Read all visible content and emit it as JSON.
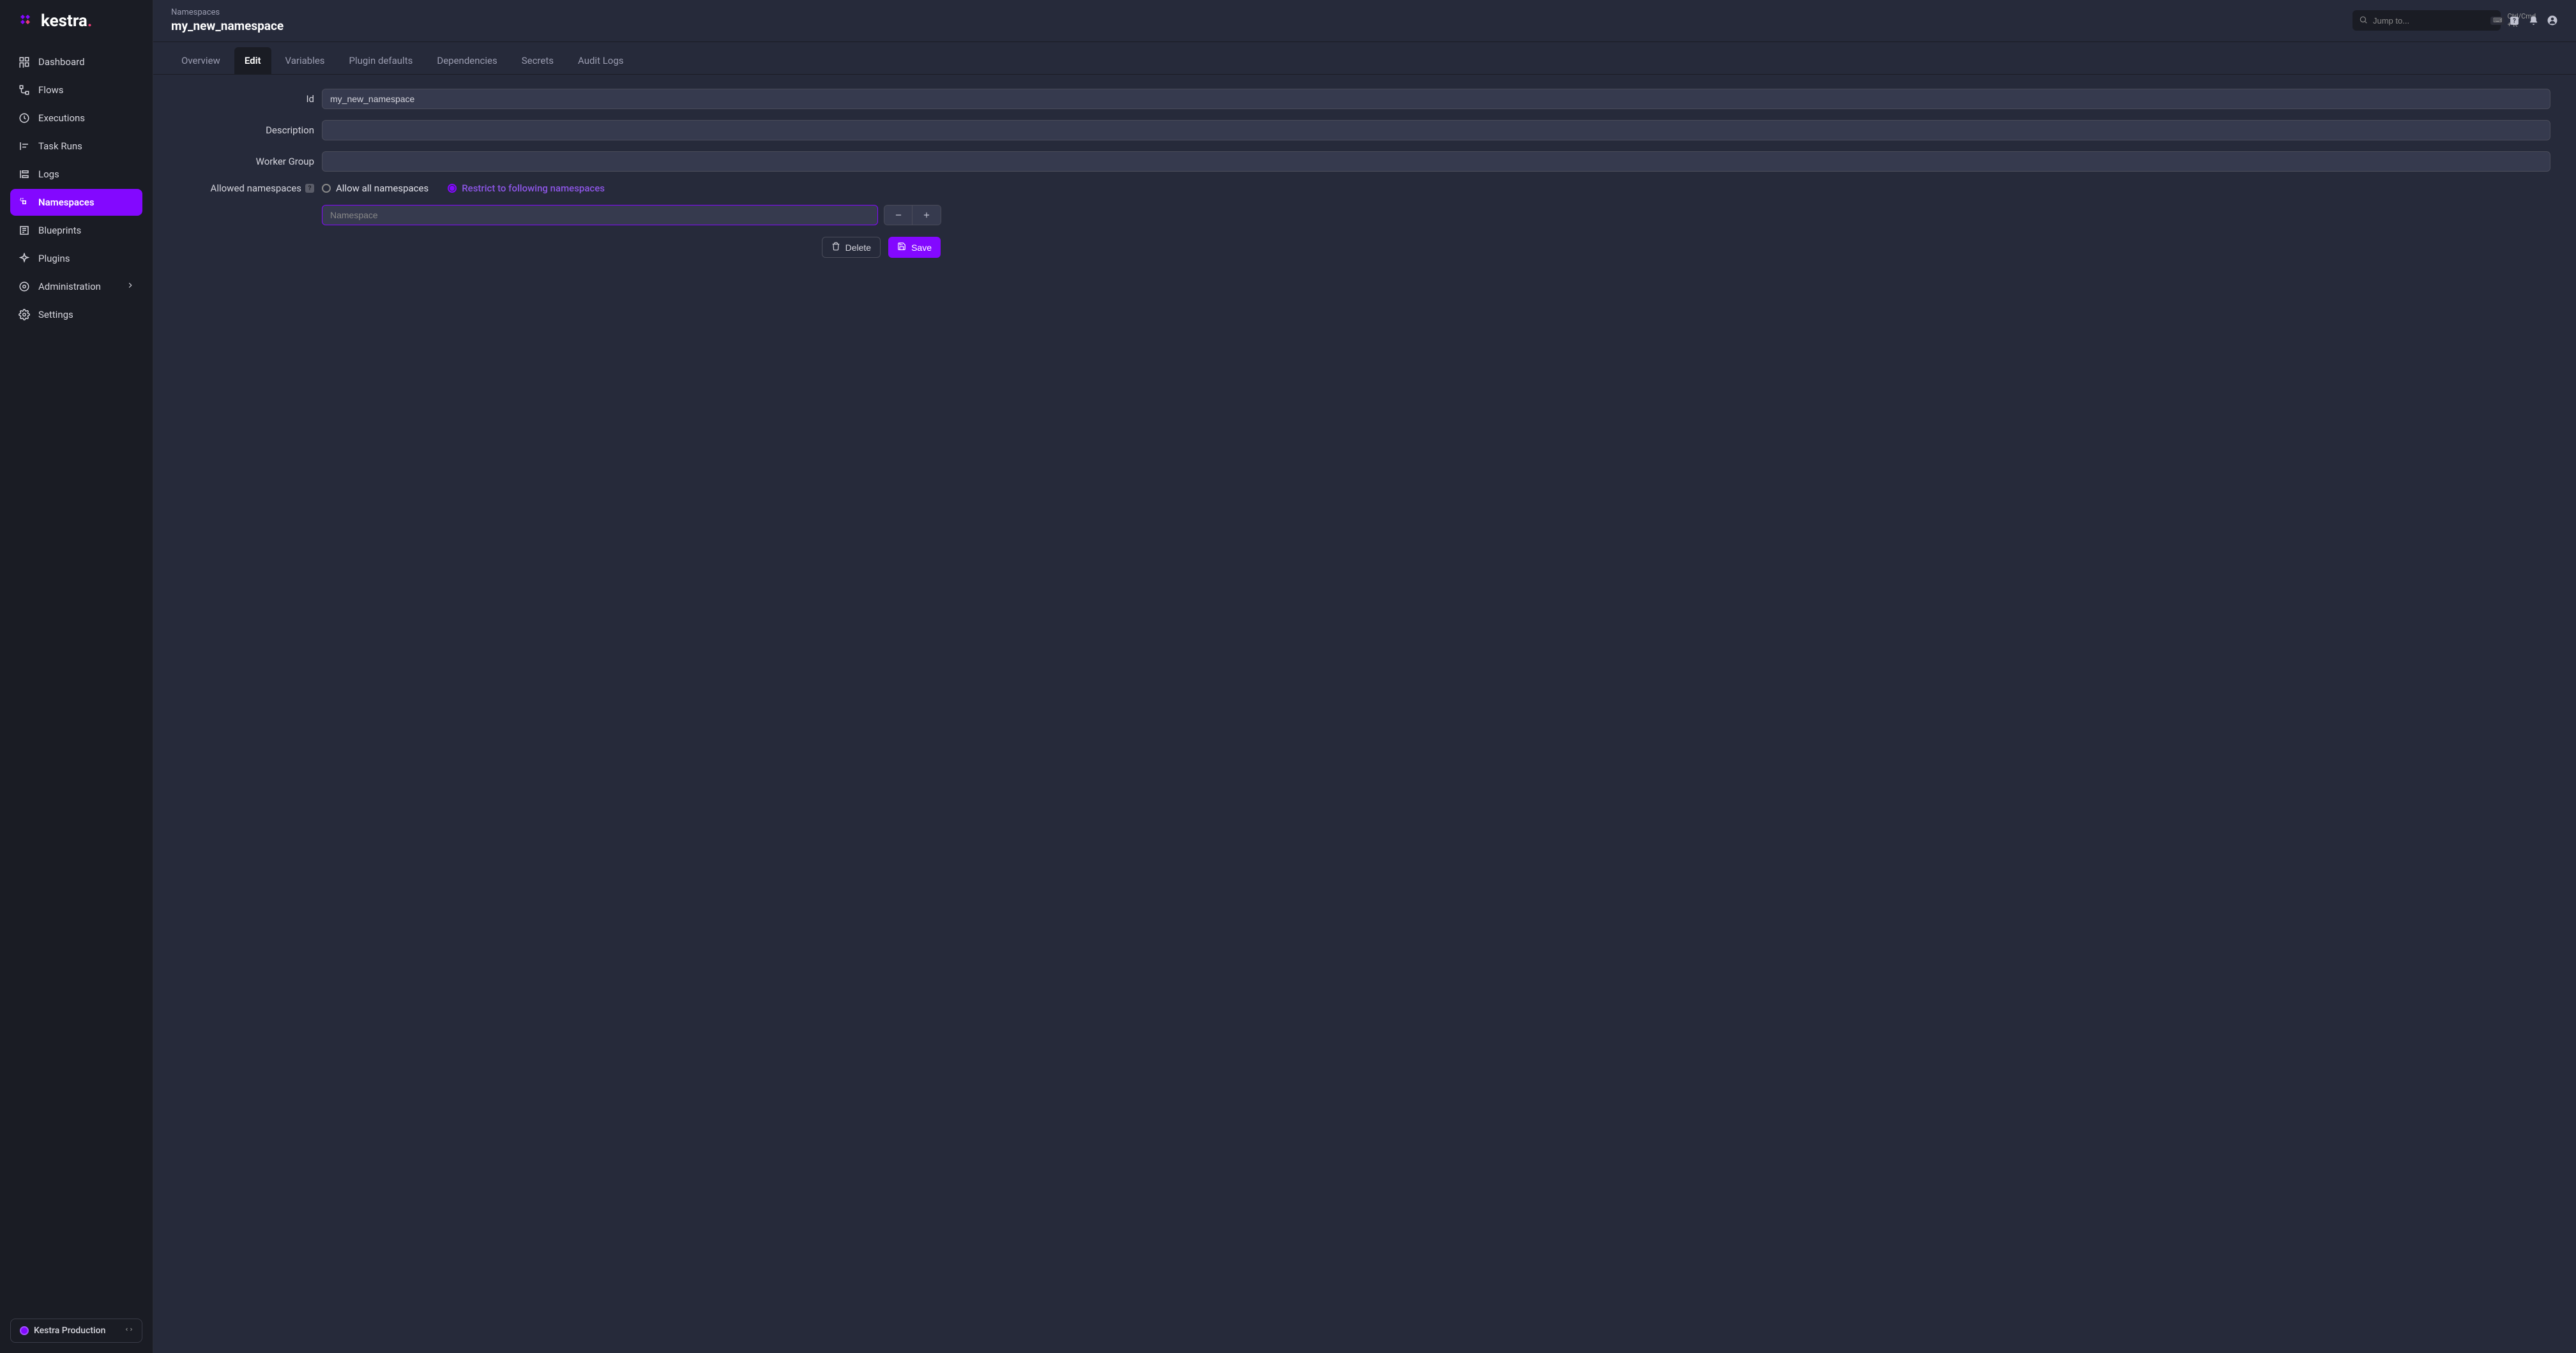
{
  "brand": {
    "name": "kestra"
  },
  "sidebar": {
    "items": [
      {
        "label": "Dashboard"
      },
      {
        "label": "Flows"
      },
      {
        "label": "Executions"
      },
      {
        "label": "Task Runs"
      },
      {
        "label": "Logs"
      },
      {
        "label": "Namespaces"
      },
      {
        "label": "Blueprints"
      },
      {
        "label": "Plugins"
      },
      {
        "label": "Administration"
      },
      {
        "label": "Settings"
      }
    ],
    "instance": "Kestra Production"
  },
  "header": {
    "breadcrumb": "Namespaces",
    "title": "my_new_namespace",
    "search_placeholder": "Jump to...",
    "shortcut": "Ctrl/Cmd + K"
  },
  "tabs": [
    {
      "label": "Overview"
    },
    {
      "label": "Edit"
    },
    {
      "label": "Variables"
    },
    {
      "label": "Plugin defaults"
    },
    {
      "label": "Dependencies"
    },
    {
      "label": "Secrets"
    },
    {
      "label": "Audit Logs"
    }
  ],
  "form": {
    "id_label": "Id",
    "id_value": "my_new_namespace",
    "description_label": "Description",
    "description_value": "",
    "worker_group_label": "Worker Group",
    "worker_group_value": "",
    "allowed_namespaces_label": "Allowed namespaces",
    "radio_allow_all": "Allow all namespaces",
    "radio_restrict": "Restrict to following namespaces",
    "namespace_placeholder": "Namespace"
  },
  "actions": {
    "delete": "Delete",
    "save": "Save"
  }
}
